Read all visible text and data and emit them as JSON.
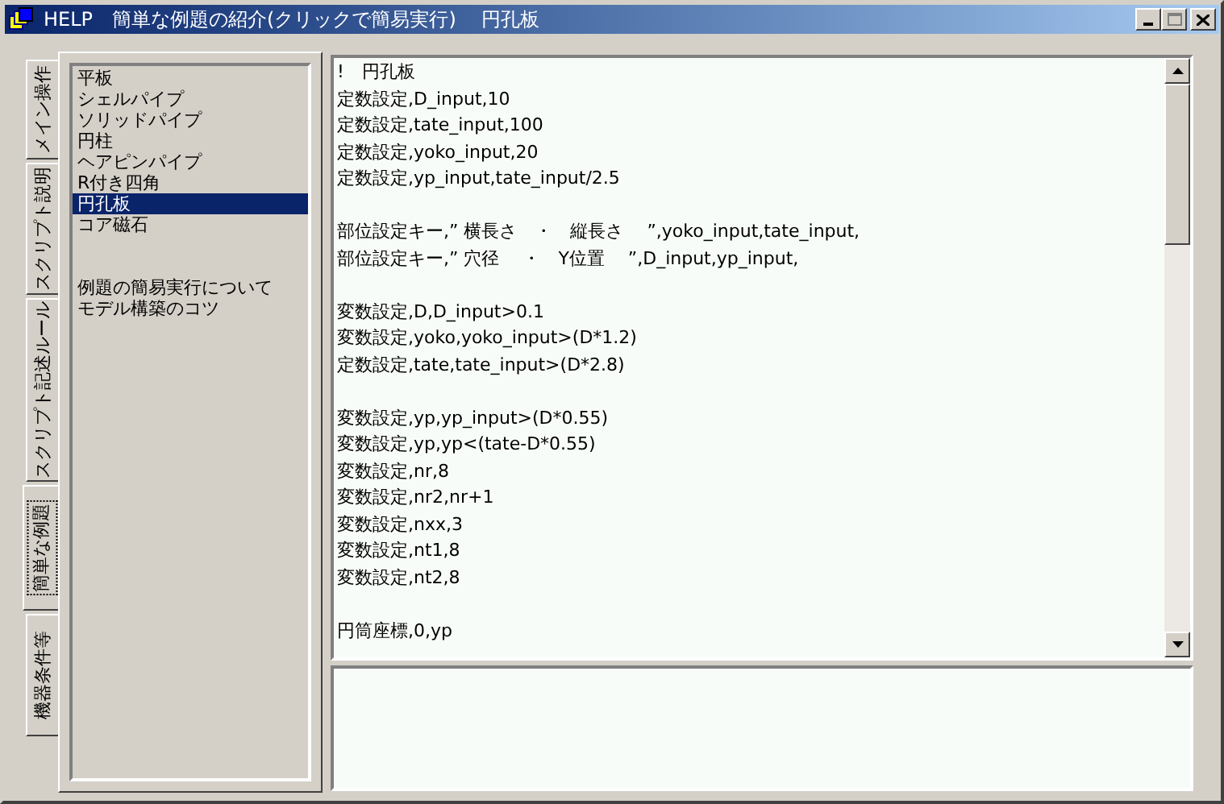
{
  "window": {
    "title": "HELP　簡単な例題の紹介(クリックで簡易実行)　 円孔板"
  },
  "tabs": [
    {
      "label": "メイン操作",
      "selected": false
    },
    {
      "label": "スクリプト説明",
      "selected": false
    },
    {
      "label": "スクリプト記述ルール",
      "selected": false
    },
    {
      "label": "簡単な例題",
      "selected": true
    },
    {
      "label": "機器条件等",
      "selected": false
    }
  ],
  "list_groups": [
    [
      {
        "label": "平板",
        "selected": false
      },
      {
        "label": "シェルパイプ",
        "selected": false
      },
      {
        "label": "ソリッドパイプ",
        "selected": false
      },
      {
        "label": "円柱",
        "selected": false
      },
      {
        "label": "ヘアピンパイプ",
        "selected": false
      },
      {
        "label": "R付き四角",
        "selected": false
      },
      {
        "label": "円孔板",
        "selected": true
      },
      {
        "label": "コア磁石",
        "selected": false
      }
    ],
    [
      {
        "label": "例題の簡易実行について",
        "selected": false
      },
      {
        "label": "モデル構築のコツ",
        "selected": false
      }
    ]
  ],
  "script_blocks": [
    [
      "!　円孔板",
      "定数設定,D_input,10",
      "定数設定,tate_input,100",
      "定数設定,yoko_input,20",
      "定数設定,yp_input,tate_input/2.5"
    ],
    [
      "部位設定キー,” 横長さ　・　縦長さ　 ”,yoko_input,tate_input,",
      "部位設定キー,” 穴径　 ・　Y位置　 ”,D_input,yp_input,"
    ],
    [
      "変数設定,D,D_input>0.1",
      "変数設定,yoko,yoko_input>(D*1.2)",
      "定数設定,tate,tate_input>(D*2.8)"
    ],
    [
      "変数設定,yp,yp_input>(D*0.55)",
      "変数設定,yp,yp<(tate-D*0.55)",
      "変数設定,nr,8",
      "変数設定,nr2,nr+1",
      "変数設定,nxx,3",
      "変数設定,nt1,8",
      "変数設定,nt2,8"
    ],
    [
      "円筒座標,0,yp"
    ]
  ]
}
